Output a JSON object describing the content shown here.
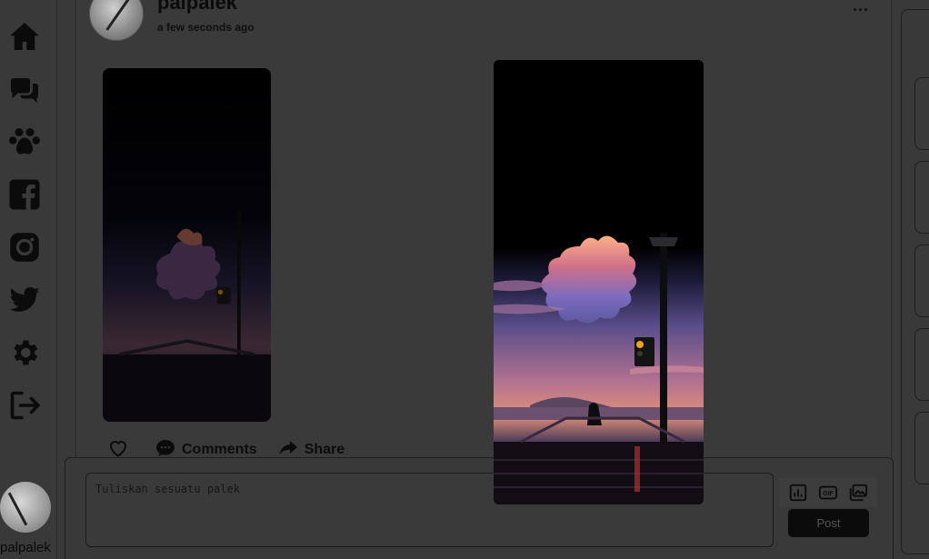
{
  "sidebar": {
    "items": [
      {
        "icon": "home-icon"
      },
      {
        "icon": "chat-icon"
      },
      {
        "icon": "groups-icon"
      },
      {
        "icon": "facebook-icon"
      },
      {
        "icon": "instagram-icon"
      },
      {
        "icon": "twitter-icon"
      },
      {
        "icon": "gear-icon"
      },
      {
        "icon": "logout-icon"
      }
    ],
    "username": "palpalek"
  },
  "post": {
    "author": "palpalek",
    "time": "a few seconds ago",
    "more": "...",
    "actions": {
      "like_icon": "heart-icon",
      "comments_label": "Comments",
      "share_label": "Share"
    }
  },
  "composer": {
    "placeholder": "Tuliskan sesuatu palek",
    "tools": [
      "poll-icon",
      "gif-icon",
      "gallery-icon"
    ],
    "post_label": "Post"
  },
  "colors": {
    "background": "#393939",
    "icon": "#0b0b0b",
    "button": "#0b0b0b"
  }
}
